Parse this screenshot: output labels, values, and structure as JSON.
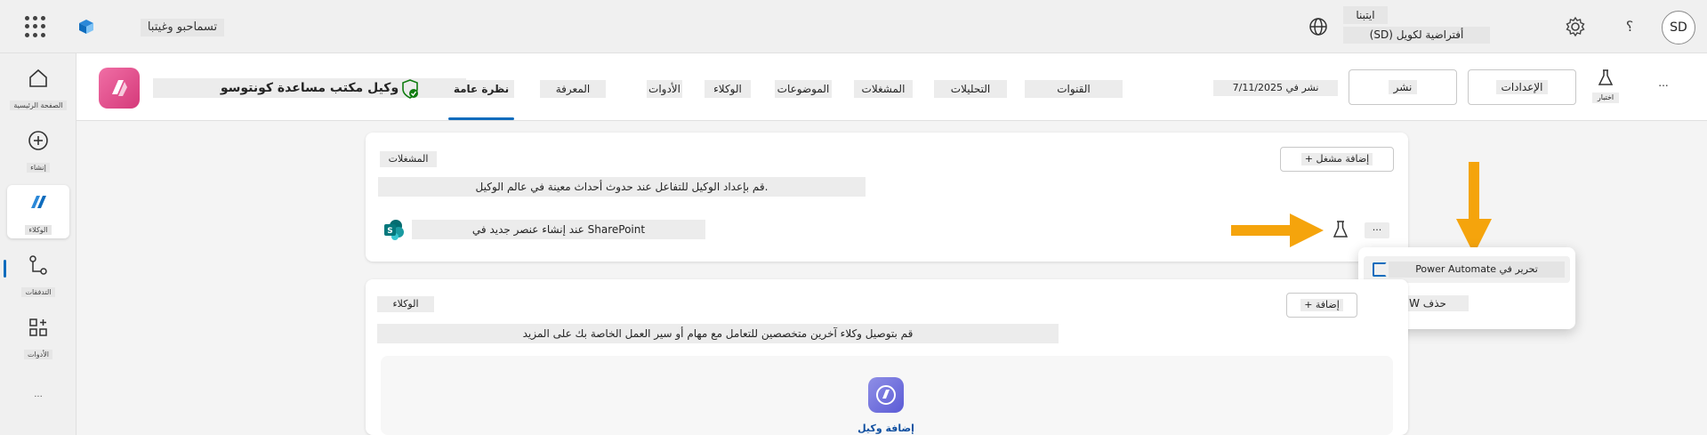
{
  "topbar": {
    "app_name": "تسماحبو وغیتبا",
    "environment_label": "ایتبنا",
    "environment_name": "(SD) أفتراضیة لکویل",
    "help_label": "؟",
    "avatar_initials": "SD"
  },
  "rail": {
    "items": [
      {
        "label": "الصفحة الرئیسیة",
        "icon": "home-icon"
      },
      {
        "label": "إنشاء",
        "icon": "plus-circle-icon"
      },
      {
        "label": "الوكلاء",
        "icon": "copilot-agents-icon"
      },
      {
        "label": "التدفقات",
        "icon": "flows-icon"
      },
      {
        "label": "الأدوات",
        "icon": "tools-icon"
      }
    ],
    "more": "..."
  },
  "header": {
    "agent_name": "وكیل مكتب مساعدة كونتوسو",
    "tabs": [
      {
        "label": "نظرة عامة",
        "selected": true
      },
      {
        "label": "المعرفة",
        "selected": false
      },
      {
        "label": "الأدوات",
        "selected": false
      },
      {
        "label": "الوكلاء",
        "selected": false
      },
      {
        "label": "الموضوعات",
        "selected": false
      },
      {
        "label": "المشغلات",
        "selected": false
      },
      {
        "label": "التحليلات",
        "selected": false
      },
      {
        "label": "القنوات",
        "selected": false
      }
    ],
    "published_date": "7/11/2025 نشر في",
    "publish_button": "نشر",
    "settings_button": "الإعدادات",
    "test_label": "اختبار",
    "more": "..."
  },
  "triggers_card": {
    "title": "المشغلات",
    "description": "قم بإعداد الوكیل للتفاعل عند حدوث أحداث معینة في عالم الوكیل.",
    "add_button": "+ إضافة مشغل",
    "trigger_name": "عند إنشاء عنصر جدید في SharePoint",
    "more": "..."
  },
  "context_menu": {
    "items": [
      {
        "label": "Power Automate تحریر في",
        "icon": "power-automate-icon"
      },
      {
        "label": "W حذف",
        "icon": "delete-icon"
      }
    ]
  },
  "agents_card": {
    "title": "الوكلاء",
    "description": "قم بتوصیل وكلاء آخرین متخصصین للتعامل مع مهام أو سیر العمل الخاصة بك على المزید",
    "add_button": "+ إضافة",
    "agent_label": "إضافة وكیل"
  },
  "colors": {
    "accent": "#0f6cbd",
    "arrow": "#f5a40c",
    "agent_logo": "#e0508f"
  }
}
